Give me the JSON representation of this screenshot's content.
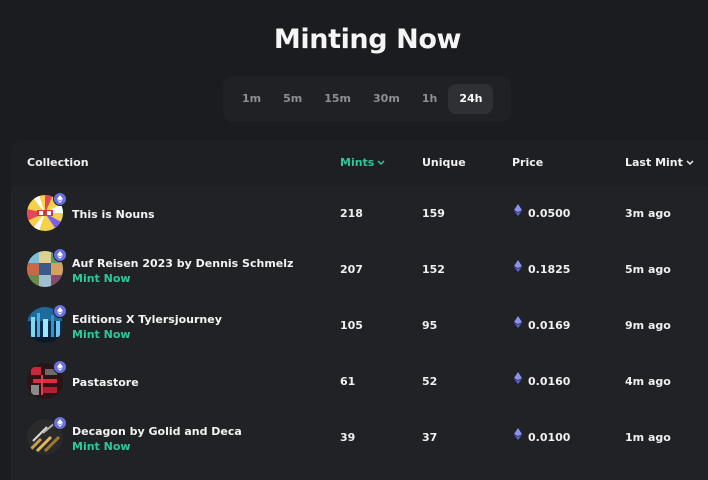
{
  "title": "Minting Now",
  "tabs": [
    {
      "label": "1m",
      "active": false
    },
    {
      "label": "5m",
      "active": false
    },
    {
      "label": "15m",
      "active": false
    },
    {
      "label": "30m",
      "active": false
    },
    {
      "label": "1h",
      "active": false
    },
    {
      "label": "24h",
      "active": true
    }
  ],
  "table": {
    "headers": {
      "collection": "Collection",
      "mints": "Mints",
      "unique": "Unique",
      "price": "Price",
      "last_mint": "Last Mint"
    },
    "sorted_column": "mints",
    "mint_now_label": "Mint Now",
    "rows": [
      {
        "name": "This is Nouns",
        "mint_now": false,
        "mints": "218",
        "unique": "159",
        "price": "0.0500",
        "last_mint": "3m ago",
        "avatar_icon": "nouns-avatar"
      },
      {
        "name": "Auf Reisen 2023 by Dennis Schmelz",
        "mint_now": true,
        "mints": "207",
        "unique": "152",
        "price": "0.1825",
        "last_mint": "5m ago",
        "avatar_icon": "auf-reisen-avatar"
      },
      {
        "name": "Editions X Tylersjourney",
        "mint_now": true,
        "mints": "105",
        "unique": "95",
        "price": "0.0169",
        "last_mint": "9m ago",
        "avatar_icon": "tylersjourney-avatar"
      },
      {
        "name": "Pastastore",
        "mint_now": false,
        "mints": "61",
        "unique": "52",
        "price": "0.0160",
        "last_mint": "4m ago",
        "avatar_icon": "pastastore-avatar"
      },
      {
        "name": "Decagon by Golid and Deca",
        "mint_now": true,
        "mints": "39",
        "unique": "37",
        "price": "0.0100",
        "last_mint": "1m ago",
        "avatar_icon": "decagon-avatar"
      }
    ]
  },
  "colors": {
    "background": "#1b1c1f",
    "accent_green": "#2fc79a",
    "eth_purple": "#6a6fe0"
  }
}
